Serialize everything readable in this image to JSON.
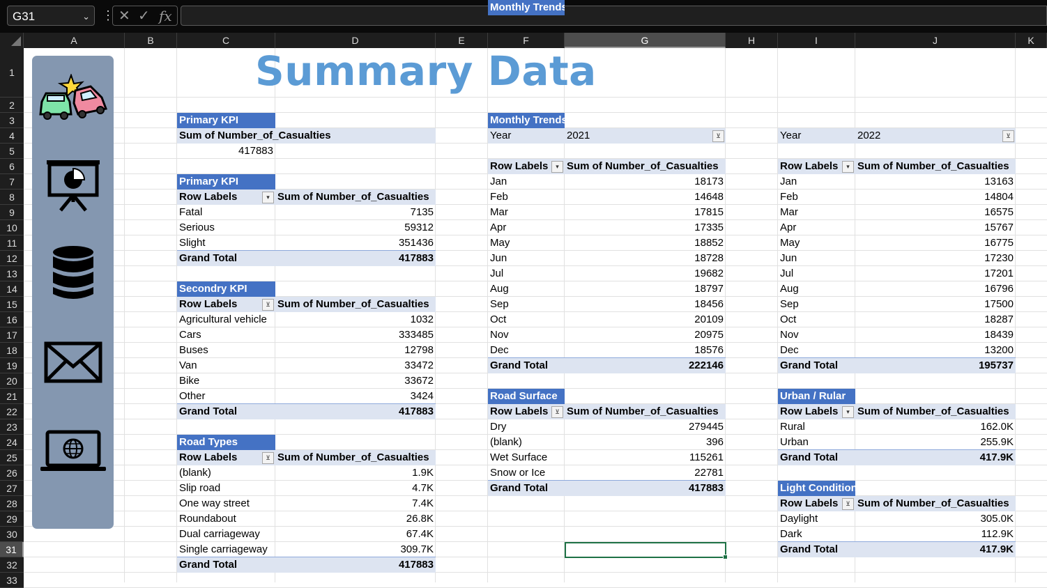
{
  "name_box": "G31",
  "formula_bar": {
    "cancel_icon": "✕",
    "enter_icon": "✓",
    "fx_label": "fx",
    "content": ""
  },
  "columns": [
    "A",
    "B",
    "C",
    "D",
    "E",
    "F",
    "G",
    "H",
    "I",
    "J",
    "K"
  ],
  "rows": [
    "1",
    "2",
    "3",
    "4",
    "5",
    "6",
    "7",
    "8",
    "9",
    "10",
    "11",
    "12",
    "13",
    "14",
    "15",
    "16",
    "17",
    "18",
    "19",
    "20",
    "21",
    "22",
    "23",
    "24",
    "25",
    "26",
    "27",
    "28",
    "29",
    "30",
    "31",
    "32",
    "33"
  ],
  "title": "Summary Data",
  "sidebar_icons": [
    "car-crash-icon",
    "presentation-chart-icon",
    "database-icon",
    "mail-icon",
    "laptop-globe-icon"
  ],
  "primary_kpi_total": {
    "header": "Primary KPI",
    "label": "Sum of Number_of_Casualties",
    "value": "417883"
  },
  "primary_kpi_severity": {
    "header": "Primary KPI",
    "col1": "Row Labels",
    "col2": "Sum of Number_of_Casualties",
    "rows": [
      [
        "Fatal",
        "7135"
      ],
      [
        "Serious",
        "59312"
      ],
      [
        "Slight",
        "351436"
      ]
    ],
    "total": [
      "Grand Total",
      "417883"
    ]
  },
  "secondary_kpi": {
    "header": "Secondry KPI",
    "col1": "Row Labels",
    "col2": "Sum of Number_of_Casualties",
    "rows": [
      [
        "Agricultural vehicle",
        "1032"
      ],
      [
        "Cars",
        "333485"
      ],
      [
        "Buses",
        "12798"
      ],
      [
        "Van",
        "33472"
      ],
      [
        "Bike",
        "33672"
      ],
      [
        "Other",
        "3424"
      ]
    ],
    "total": [
      "Grand Total",
      "417883"
    ]
  },
  "road_types": {
    "header": "Road Types",
    "col1": "Row Labels",
    "col2": "Sum of Number_of_Casualties",
    "rows": [
      [
        "(blank)",
        "1.9K"
      ],
      [
        "Slip road",
        "4.7K"
      ],
      [
        "One way street",
        "7.4K"
      ],
      [
        "Roundabout",
        "26.8K"
      ],
      [
        "Dual carriageway",
        "67.4K"
      ],
      [
        "Single carriageway",
        "309.7K"
      ]
    ],
    "total": [
      "Grand Total",
      "417883"
    ]
  },
  "monthly_2021": {
    "header": "Monthly Trends",
    "filter_label": "Year",
    "filter_value": "2021",
    "col1": "Row Labels",
    "col2": "Sum of Number_of_Casualties",
    "rows": [
      [
        "Jan",
        "18173"
      ],
      [
        "Feb",
        "14648"
      ],
      [
        "Mar",
        "17815"
      ],
      [
        "Apr",
        "17335"
      ],
      [
        "May",
        "18852"
      ],
      [
        "Jun",
        "18728"
      ],
      [
        "Jul",
        "19682"
      ],
      [
        "Aug",
        "18797"
      ],
      [
        "Sep",
        "18456"
      ],
      [
        "Oct",
        "20109"
      ],
      [
        "Nov",
        "20975"
      ],
      [
        "Dec",
        "18576"
      ]
    ],
    "total": [
      "Grand Total",
      "222146"
    ]
  },
  "monthly_2022": {
    "filter_label": "Year",
    "filter_value": "2022",
    "col1": "Row Labels",
    "col2": "Sum of Number_of_Casualties",
    "rows": [
      [
        "Jan",
        "13163"
      ],
      [
        "Feb",
        "14804"
      ],
      [
        "Mar",
        "16575"
      ],
      [
        "Apr",
        "15767"
      ],
      [
        "May",
        "16775"
      ],
      [
        "Jun",
        "17230"
      ],
      [
        "Jul",
        "17201"
      ],
      [
        "Aug",
        "16796"
      ],
      [
        "Sep",
        "17500"
      ],
      [
        "Oct",
        "18287"
      ],
      [
        "Nov",
        "18439"
      ],
      [
        "Dec",
        "13200"
      ]
    ],
    "total": [
      "Grand Total",
      "195737"
    ]
  },
  "road_surface": {
    "header": "Road Surface",
    "col1": "Row Labels",
    "col2": "Sum of Number_of_Casualties",
    "rows": [
      [
        "Dry",
        "279445"
      ],
      [
        "(blank)",
        "396"
      ],
      [
        "Wet Surface",
        "115261"
      ],
      [
        "Snow or Ice",
        "22781"
      ]
    ],
    "total": [
      "Grand Total",
      "417883"
    ]
  },
  "urban_rural": {
    "header": "Urban / Rular",
    "col1": "Row Labels",
    "col2": "Sum of Number_of_Casualties",
    "rows": [
      [
        "Rural",
        "162.0K"
      ],
      [
        "Urban",
        "255.9K"
      ]
    ],
    "total": [
      "Grand Total",
      "417.9K"
    ]
  },
  "light_condition": {
    "header": "Light Condition",
    "col1": "Row Labels",
    "col2": "Sum of Number_of_Casualties",
    "rows": [
      [
        "Daylight",
        "305.0K"
      ],
      [
        "Dark",
        "112.9K"
      ]
    ],
    "total": [
      "Grand Total",
      "417.9K"
    ]
  }
}
